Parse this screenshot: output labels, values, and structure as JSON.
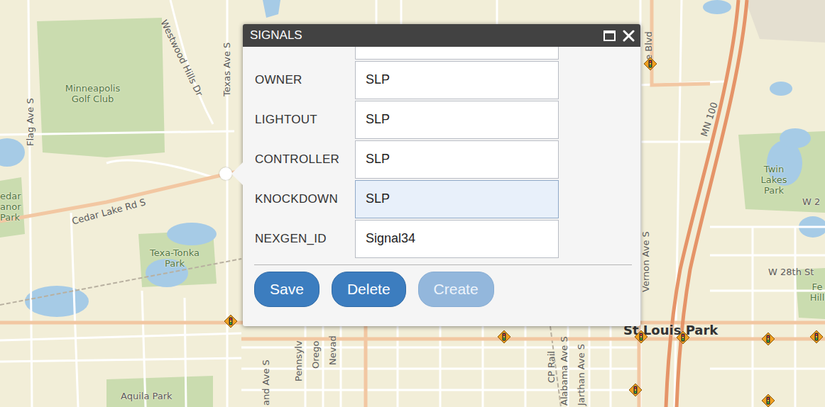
{
  "popup": {
    "title": "SIGNALS",
    "fields": [
      {
        "label": "OWNER",
        "value": "SLP",
        "focused": false
      },
      {
        "label": "LIGHTOUT",
        "value": "SLP",
        "focused": false
      },
      {
        "label": "CONTROLLER",
        "value": "SLP",
        "focused": false
      },
      {
        "label": "KNOCKDOWN",
        "value": "SLP",
        "focused": true
      },
      {
        "label": "NEXGEN_ID",
        "value": "Signal34",
        "focused": false
      }
    ],
    "buttons": [
      {
        "label": "Save",
        "disabled": false
      },
      {
        "label": "Delete",
        "disabled": false
      },
      {
        "label": "Create",
        "disabled": true
      }
    ]
  },
  "map": {
    "labels": [
      {
        "text": "Westwood Hills Dr"
      },
      {
        "text": "Texas Ave S"
      },
      {
        "text": "Minneapolis Golf Club"
      },
      {
        "text": "Flag Ave S"
      },
      {
        "text": "Cedar Lake Rd S"
      },
      {
        "text": "edar anor Park"
      },
      {
        "text": "Texa-Tonka Park"
      },
      {
        "text": "Twin Lakes Park"
      },
      {
        "text": "MN 100"
      },
      {
        "text": "Vernon Ave S"
      },
      {
        "text": "W 2"
      },
      {
        "text": "W 28th St"
      },
      {
        "text": "Fe Hill"
      },
      {
        "text": "St Louis Park"
      },
      {
        "text": "Aquila Park"
      },
      {
        "text": "Pennsylv"
      },
      {
        "text": "Orego"
      },
      {
        "text": "Nevad"
      },
      {
        "text": "and Ave S"
      },
      {
        "text": "Alabama Ave S"
      },
      {
        "text": "Jarthan Ave S"
      },
      {
        "text": "CP Rail"
      },
      {
        "text": "ce Blvd"
      }
    ]
  }
}
